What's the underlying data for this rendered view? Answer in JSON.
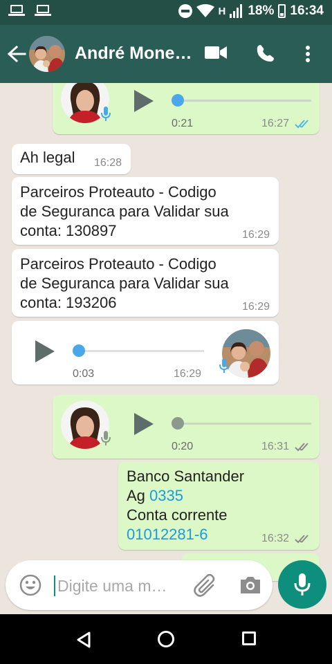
{
  "status_bar": {
    "network_label": "H",
    "battery": "18%",
    "time": "16:34"
  },
  "header": {
    "title": "André Mone…"
  },
  "messages": {
    "voice_out_1": {
      "duration": "0:21",
      "time": "16:27",
      "status": "read"
    },
    "text_in_1": {
      "text": "Ah legal",
      "time": "16:28"
    },
    "text_in_2": {
      "line1": "Parceiros Proteauto - Codigo",
      "line2": "de Seguranca para Validar sua",
      "line3": "conta: 130897",
      "time": "16:29"
    },
    "text_in_3": {
      "line1": "Parceiros Proteauto - Codigo",
      "line2": "de Seguranca para Validar sua",
      "line3": "conta: 193206",
      "time": "16:29"
    },
    "voice_in_1": {
      "duration": "0:03",
      "time": "16:29"
    },
    "voice_out_2": {
      "duration": "0:20",
      "time": "16:31",
      "status": "delivered"
    },
    "text_out_1": {
      "line1": "Banco Santander",
      "line2_prefix": "Ag ",
      "line2_link": "0335",
      "line3": "Conta corrente",
      "line4_link": "01012281-6",
      "time": "16:32",
      "status": "delivered"
    }
  },
  "input": {
    "placeholder": "Digite uma m…"
  },
  "colors": {
    "header": "#2a5d55",
    "status_bar": "#234f47",
    "incoming_bubble": "#ffffff",
    "outgoing_bubble": "#dcf8c6",
    "read_ticks": "#4fb6ec",
    "voice_unplayed_dot": "#4aa8e8",
    "mic_button": "#0e8f7e",
    "link": "#1a9bdb",
    "chat_background": "#ece5dd"
  },
  "icons": {
    "back": "arrow-left-icon",
    "video": "video-camera-icon",
    "call": "phone-icon",
    "menu": "more-vert-icon",
    "emoji": "smiley-icon",
    "attach": "paperclip-icon",
    "camera": "camera-icon",
    "mic": "microphone-icon"
  }
}
